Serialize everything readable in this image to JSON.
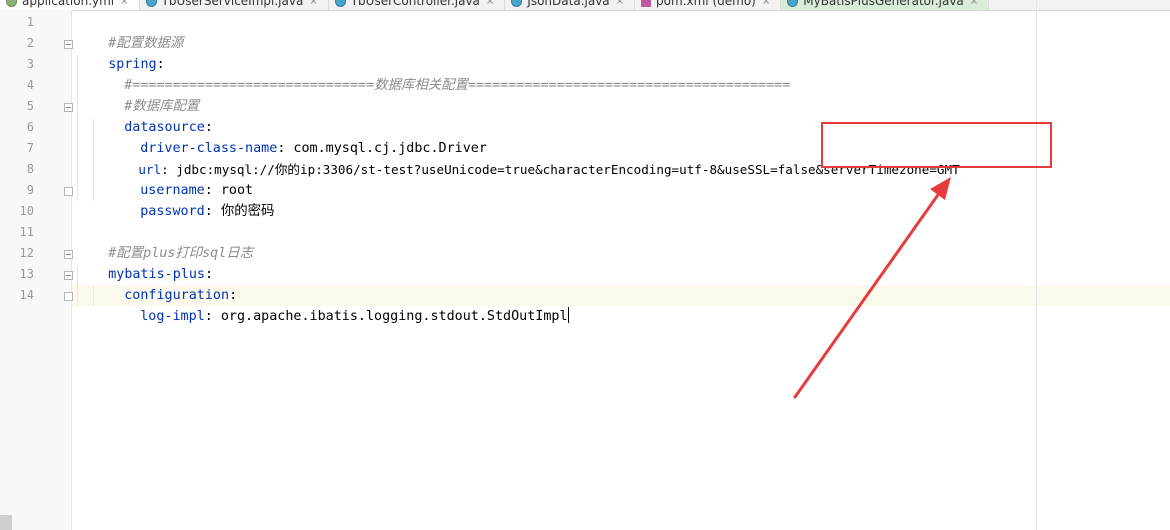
{
  "tabs": [
    {
      "label": "application.yml",
      "icon": "yml-file-icon",
      "active": true,
      "close": "×"
    },
    {
      "label": "TbUserServiceImpl.java",
      "icon": "java-class-icon",
      "close": "×"
    },
    {
      "label": "TbUserController.java",
      "icon": "java-class-icon",
      "close": "×"
    },
    {
      "label": "JsonData.java",
      "icon": "java-class-icon",
      "close": "×"
    },
    {
      "label": "pom.xml (demo)",
      "icon": "maven-icon",
      "close": "×"
    },
    {
      "label": "MyBatisPlusGenerator.java",
      "icon": "java-class-icon",
      "close": "×"
    }
  ],
  "editor": {
    "line_numbers": [
      "1",
      "2",
      "3",
      "4",
      "5",
      "6",
      "7",
      "8",
      "9",
      "10",
      "11",
      "12",
      "13",
      "14"
    ],
    "lines": {
      "l1": {
        "comment": "#配置数据源"
      },
      "l2": {
        "key": "spring",
        "colon": ":"
      },
      "l3": {
        "comment": "#==============================数据库相关配置========================================"
      },
      "l4": {
        "comment": "#数据库配置"
      },
      "l5": {
        "key": "datasource",
        "colon": ":"
      },
      "l6": {
        "key": "driver-class-name",
        "colon": ":",
        "value": " com.mysql.cj.jdbc.Driver"
      },
      "l7": {
        "key": "url",
        "colon": ":",
        "value": " jdbc:mysql://你的ip:3306/st-test?useUnicode=true&characterEncoding=utf-8&useSSL=false&serverTimezone=GMT"
      },
      "l8": {
        "key": "username",
        "colon": ":",
        "value": " root"
      },
      "l9": {
        "key": "password",
        "colon": ":",
        "value": " 你的密码"
      },
      "l10": {},
      "l11": {
        "comment": "#配置plus打印sql日志"
      },
      "l12": {
        "key": "mybatis-plus",
        "colon": ":"
      },
      "l13": {
        "key": "configuration",
        "colon": ":"
      },
      "l14": {
        "key": "log-impl",
        "colon": ":",
        "value": " org.apache.ibatis.logging.stdout.StdOutImpl"
      }
    }
  },
  "colors": {
    "key": "#0033b3",
    "comment": "#8c8c8c",
    "annotation": "#e83b3b",
    "caret_line": "#fcfaed"
  }
}
